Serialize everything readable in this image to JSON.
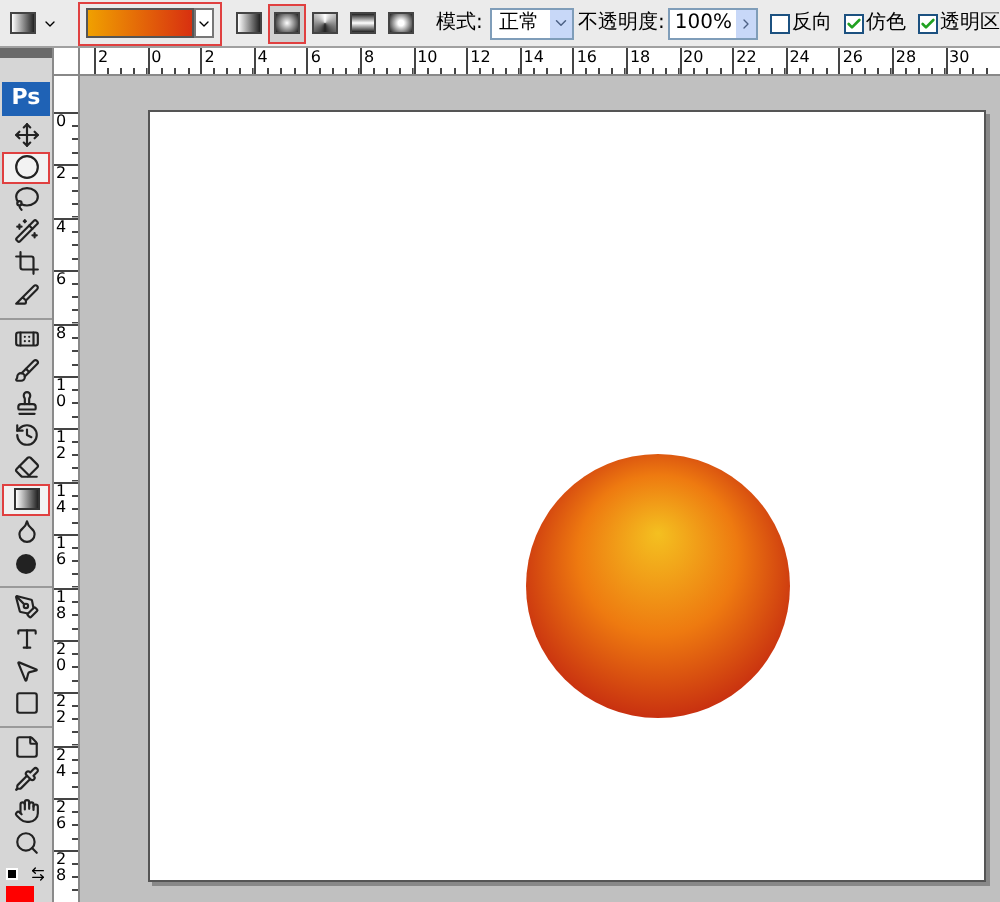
{
  "options_bar": {
    "gradient_picker": {
      "highlighted": true
    },
    "gradient_types": [
      {
        "selected": false,
        "highlighted": false
      },
      {
        "selected": true,
        "highlighted": true
      },
      {
        "selected": false,
        "highlighted": false
      },
      {
        "selected": false,
        "highlighted": false
      },
      {
        "selected": false,
        "highlighted": false
      }
    ],
    "mode_label": "模式:",
    "mode_value": "正常",
    "opacity_label": "不透明度:",
    "opacity_value": "100%",
    "checkboxes": [
      {
        "label": "反向",
        "checked": false
      },
      {
        "label": "仿色",
        "checked": true
      },
      {
        "label": "透明区",
        "checked": true
      }
    ]
  },
  "toolbox": {
    "logo": "Ps",
    "tool_groups": [
      {
        "tools": [
          {
            "highlighted": false
          },
          {
            "highlighted": true
          },
          {
            "highlighted": false
          },
          {
            "highlighted": false
          },
          {
            "highlighted": false
          },
          {
            "highlighted": false
          }
        ]
      },
      {
        "tools": [
          {
            "highlighted": false
          },
          {
            "highlighted": false
          },
          {
            "highlighted": false
          },
          {
            "highlighted": false
          },
          {
            "highlighted": false
          },
          {
            "highlighted": true
          },
          {
            "highlighted": false
          },
          {
            "highlighted": false
          }
        ]
      },
      {
        "tools": [
          {
            "highlighted": false
          },
          {
            "highlighted": false
          },
          {
            "highlighted": false
          },
          {
            "highlighted": false
          }
        ]
      },
      {
        "tools": [
          {
            "highlighted": false
          },
          {
            "highlighted": false
          },
          {
            "highlighted": false
          },
          {
            "highlighted": false
          }
        ]
      }
    ],
    "swatches": [
      {
        "color": "#ff0000"
      }
    ]
  },
  "horizontal_ruler": {
    "labels": [
      "2",
      "0",
      "2",
      "4",
      "6",
      "8",
      "10",
      "12",
      "14",
      "16",
      "18",
      "20",
      "22",
      "24",
      "26",
      "28",
      "30"
    ]
  },
  "vertical_ruler": {
    "labels": [
      "0",
      "2",
      "4",
      "6",
      "8",
      "10",
      "12",
      "14",
      "16",
      "18",
      "20",
      "22",
      "24",
      "26",
      "28"
    ]
  }
}
